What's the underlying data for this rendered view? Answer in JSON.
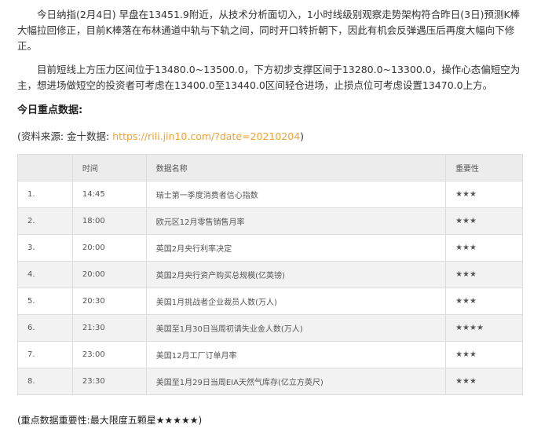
{
  "article": {
    "paragraph1": "今日纳指(2月4日) 早盘在13451.9附近，从技术分析面切入，1小时线级别观察走势架构符合昨日(3日)预测K棒大幅拉回修正，目前K棒落在布林通道中轨与下轨之间，同时开口转折朝下，因此有机会反弹遇压后再度大幅向下修正。",
    "paragraph2": "目前短线上方压力区间位于13480.0~13500.0，下方初步支撑区间于13280.0~13300.0，操作心态偏短空为主，想进场做短空的投资者可考虑在13400.0至13440.0区间轻仓进场，止损点位可考虑设置13470.0上方。",
    "heading": "今日重点数据:",
    "source_prefix": "(资料来源: 金十数据: ",
    "source_link": "https://rili.jin10.com/?date=20210204",
    "source_suffix": ")",
    "footer": "(重点数据重要性:最大限度五颗星★★★★★)"
  },
  "table": {
    "headers": [
      "",
      "时间",
      "数据名称",
      "重要性"
    ],
    "rows": [
      [
        "1.",
        "14:45",
        "瑞士第一季度消费者信心指数",
        "★★★"
      ],
      [
        "2.",
        "18:00",
        "欧元区12月零售销售月率",
        "★★★"
      ],
      [
        "3.",
        "20:00",
        "英国2月央行利率决定",
        "★★★"
      ],
      [
        "4.",
        "20:00",
        "英国2月央行资产购买总规模(亿英镑)",
        "★★★"
      ],
      [
        "5.",
        "20:30",
        "美国1月挑战者企业裁员人数(万人)",
        "★★★"
      ],
      [
        "6.",
        "21:30",
        "美国至1月30日当周初请失业金人数(万人)",
        "★★★★"
      ],
      [
        "7.",
        "23:00",
        "美国12月工厂订单月率",
        "★★★"
      ],
      [
        "8.",
        "23:30",
        "美国至1月29日当周EIA天然气库存(亿立方英尺)",
        "★★★"
      ]
    ]
  }
}
